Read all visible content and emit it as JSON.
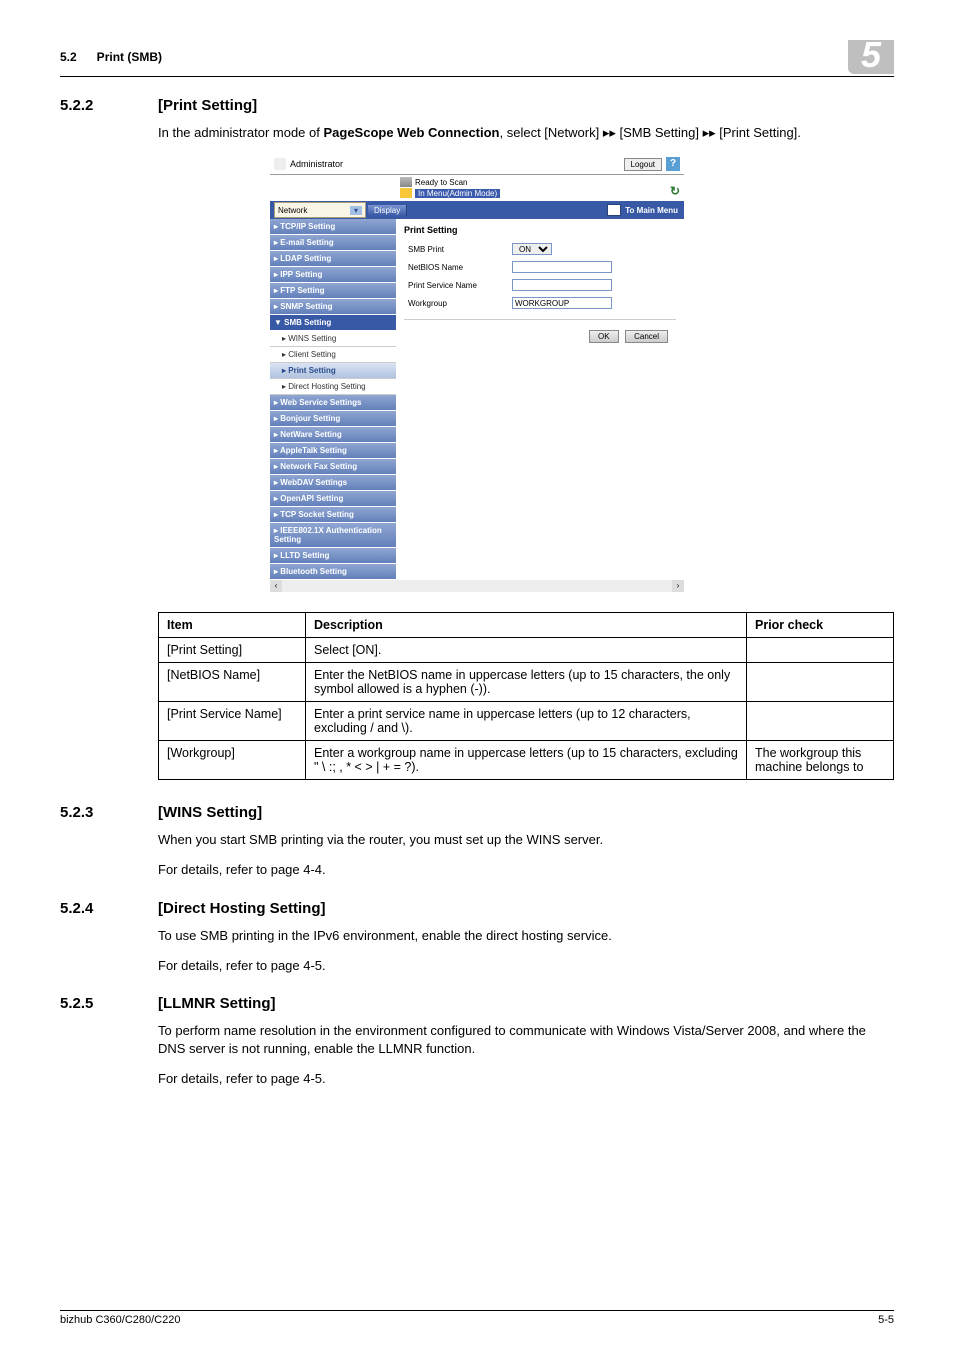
{
  "header": {
    "left": "5.2      Print (SMB)",
    "badge": "5"
  },
  "s522": {
    "num": "5.2.2",
    "name": "[Print Setting]",
    "intro_a": "In the administrator mode of ",
    "intro_b_bold": "PageScope Web Connection",
    "intro_c": ", select [Network] ",
    "arrows1": "▸▸",
    "intro_d": " [SMB Setting] ",
    "arrows2": "▸▸",
    "intro_e": " [Print Setting]."
  },
  "shot": {
    "admin": "Administrator",
    "logout": "Logout",
    "help": "?",
    "status1": "Ready to Scan",
    "status2": "In Menu(Admin Mode)",
    "network": "Network",
    "arrow_down": "▾",
    "display": "Display",
    "to_main": "To Main Menu",
    "sidebar": [
      "TCP/IP Setting",
      "E-mail Setting",
      "LDAP Setting",
      "IPP Setting",
      "FTP Setting",
      "SNMP Setting"
    ],
    "sidebar_dark": "SMB Setting",
    "subs": [
      "WINS Setting",
      "Client Setting",
      "Print Setting",
      "Direct Hosting Setting"
    ],
    "sidebar2": [
      "Web Service Settings",
      "Bonjour Setting",
      "NetWare Setting",
      "AppleTalk Setting",
      "Network Fax Setting",
      "WebDAV Settings",
      "OpenAPI Setting",
      "TCP Socket Setting",
      "IEEE802.1X Authentication Setting",
      "LLTD Setting",
      "Bluetooth Setting"
    ],
    "main_title": "Print Setting",
    "rows": {
      "smb_print": "SMB Print",
      "netbios": "NetBIOS Name",
      "psn": "Print Service Name",
      "workgroup": "Workgroup"
    },
    "values": {
      "smb_print_on": "ON",
      "workgroup": "WORKGROUP",
      "netbios": "",
      "psn": ""
    },
    "ok": "OK",
    "cancel": "Cancel"
  },
  "table": {
    "head": [
      "Item",
      "Description",
      "Prior check"
    ],
    "rows": [
      {
        "item": "[Print Setting]",
        "desc": "Select [ON].",
        "prior": ""
      },
      {
        "item": "[NetBIOS Name]",
        "desc": "Enter the NetBIOS name in uppercase letters (up to 15 characters, the only symbol allowed is a hyphen (-)).",
        "prior": ""
      },
      {
        "item": "[Print Service Name]",
        "desc": "Enter a print service name in uppercase letters (up to 12 characters, excluding / and \\).",
        "prior": ""
      },
      {
        "item": "[Workgroup]",
        "desc": "Enter a workgroup name in uppercase letters (up to 15 characters, excluding \" \\ :; , * < > | + = ?).",
        "prior": "The workgroup this machine belongs to"
      }
    ]
  },
  "s523": {
    "num": "5.2.3",
    "name": "[WINS Setting]",
    "p1": "When you start SMB printing via the router, you must set up the WINS server.",
    "p2": "For details, refer to page 4-4."
  },
  "s524": {
    "num": "5.2.4",
    "name": "[Direct Hosting Setting]",
    "p1": "To use SMB printing in the IPv6 environment, enable the direct hosting service.",
    "p2": "For details, refer to page 4-5."
  },
  "s525": {
    "num": "5.2.5",
    "name": "[LLMNR Setting]",
    "p1": "To perform name resolution in the environment configured to communicate with Windows Vista/Server 2008, and where the DNS server is not running, enable the LLMNR function.",
    "p2": "For details, refer to page 4-5."
  },
  "footer": {
    "left": "bizhub C360/C280/C220",
    "right": "5-5"
  }
}
